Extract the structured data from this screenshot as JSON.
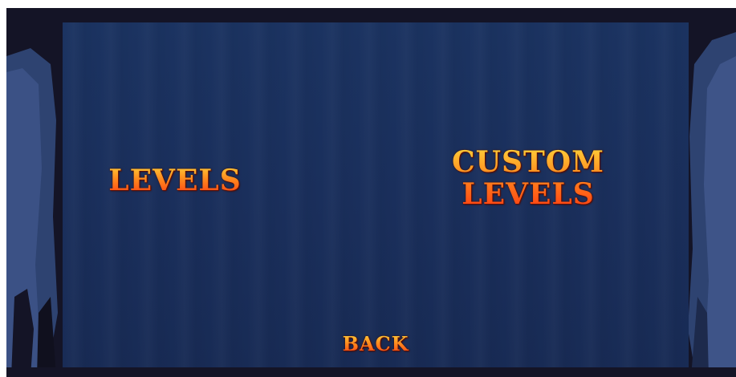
{
  "menu": {
    "levels_label": "LEVELS",
    "custom_levels_line1": "CUSTOM",
    "custom_levels_line2": "LEVELS",
    "back_label": "BACK"
  },
  "colors": {
    "frame": "#141426",
    "panel": "#1a2f5c",
    "text_top": "#ffd23a",
    "text_bottom": "#ff3b12",
    "text_outline": "#5a0f0a"
  }
}
